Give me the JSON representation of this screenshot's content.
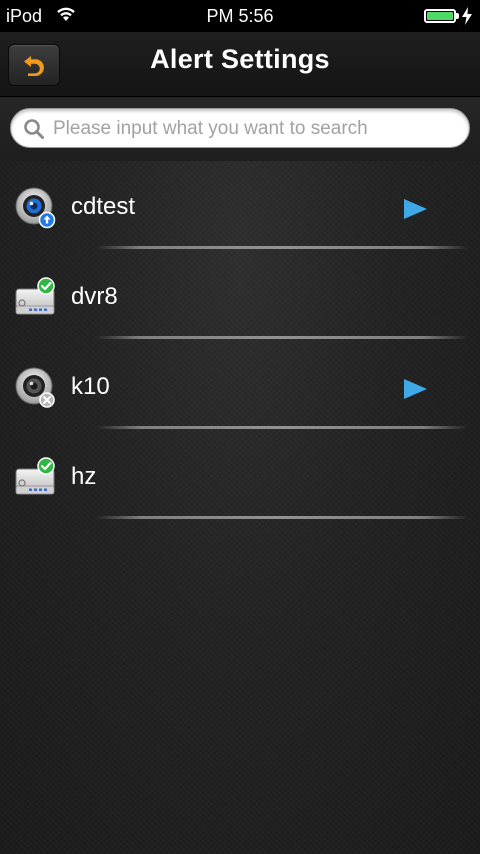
{
  "status_bar": {
    "carrier": "iPod",
    "time": "PM 5:56",
    "battery_level_percent": 100,
    "charging": true,
    "battery_color": "#4cd964"
  },
  "navbar": {
    "title": "Alert Settings",
    "back_icon": "back-arrow-icon",
    "back_icon_color": "#f19a1c"
  },
  "search": {
    "placeholder": "Please input what you want to search",
    "value": ""
  },
  "devices": [
    {
      "name": "cdtest",
      "icon": "ip-camera-icon",
      "status": "upload-badge",
      "has_arrow": true
    },
    {
      "name": "dvr8",
      "icon": "dvr-icon",
      "status": "online-check-badge",
      "has_arrow": false
    },
    {
      "name": "k10",
      "icon": "ip-camera-icon",
      "status": "offline-x-badge",
      "has_arrow": true
    },
    {
      "name": "hz",
      "icon": "dvr-icon",
      "status": "online-check-badge",
      "has_arrow": false
    }
  ],
  "colors": {
    "arrow": "#3ea9e6",
    "online": "#2fb844"
  }
}
